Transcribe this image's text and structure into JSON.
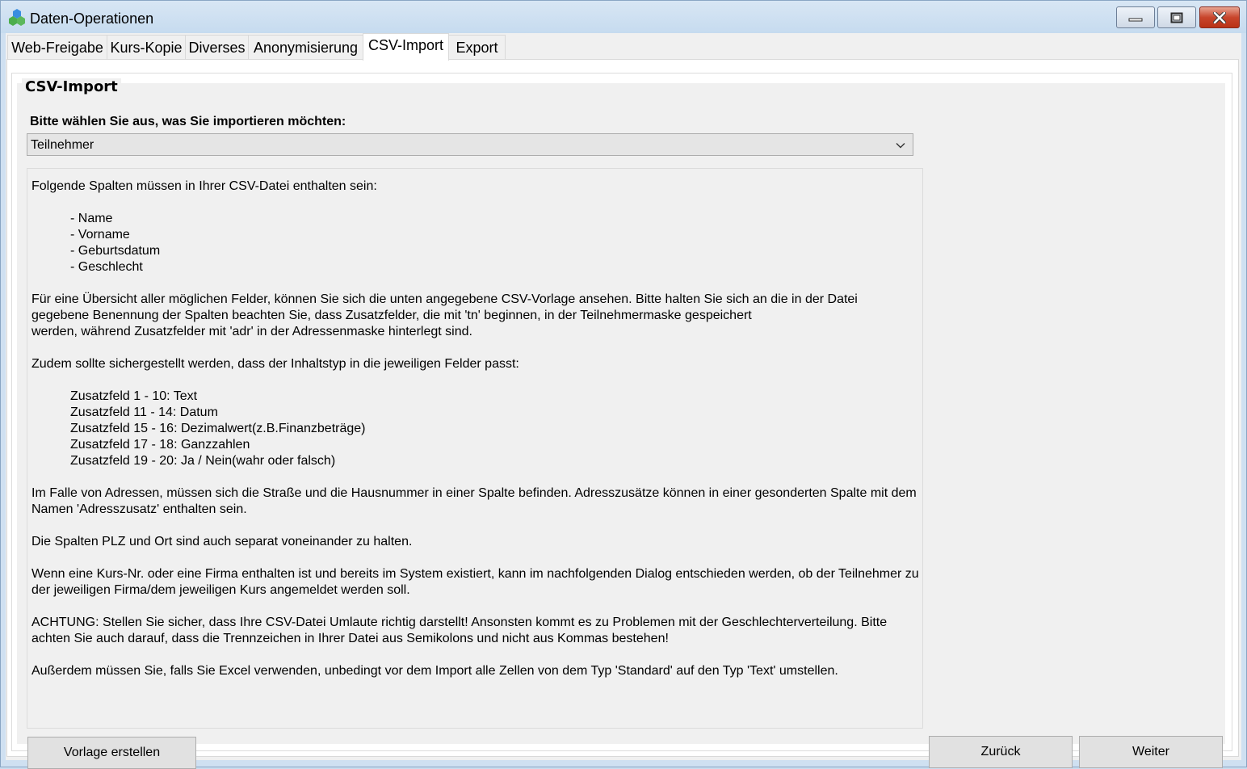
{
  "window": {
    "title": "Daten-Operationen",
    "app_icon": "hexagon-cluster-icon",
    "controls": [
      "minimize-icon",
      "maximize-icon",
      "close-icon"
    ]
  },
  "tabs": [
    {
      "label": "Web-Freigabe",
      "active": false
    },
    {
      "label": "Kurs-Kopie",
      "active": false
    },
    {
      "label": "Diverses",
      "active": false
    },
    {
      "label": "Anonymisierung",
      "active": false
    },
    {
      "label": "CSV-Import",
      "active": true
    },
    {
      "label": "Export",
      "active": false
    }
  ],
  "group": {
    "title": "CSV-Import",
    "prompt": "Bitte wählen Sie aus, was Sie importieren möchten:",
    "select": {
      "value": "Teilnehmer",
      "icon": "chevron-down-icon"
    }
  },
  "info": {
    "intro": "Folgende Spalten müssen in Ihrer CSV-Datei enthalten sein:",
    "required_columns": [
      "- Name",
      "- Vorname",
      "- Geburtsdatum",
      "- Geschlecht"
    ],
    "overview_lines": [
      "Für eine Übersicht aller möglichen Felder, können Sie sich die unten angegebene CSV-Vorlage ansehen. Bitte halten Sie sich an die in der Datei",
      "gegebene Benennung der Spalten beachten Sie, dass Zusatzfelder, die mit 'tn' beginnen, in der Teilnehmermaske gespeichert",
      "werden, während Zusatzfelder mit 'adr' in der Adressenmaske hinterlegt sind."
    ],
    "types_intro": "Zudem sollte sichergestellt werden, dass der Inhaltstyp in die jeweiligen Felder passt:",
    "field_types": [
      "Zusatzfeld 1 - 10: Text",
      "Zusatzfeld 11 - 14: Datum",
      "Zusatzfeld 15 - 16: Dezimalwert(z.B.Finanzbeträge)",
      "Zusatzfeld 17 - 18: Ganzzahlen",
      "Zusatzfeld 19 - 20: Ja / Nein(wahr oder falsch)"
    ],
    "address_lines": [
      "Im Falle von Adressen, müssen sich die Straße und die Hausnummer in einer Spalte befinden. Adresszusätze können in einer gesonderten Spalte mit dem",
      "Namen 'Adresszusatz' enthalten sein."
    ],
    "plz_line": "Die Spalten PLZ und Ort sind auch separat voneinander zu halten.",
    "course_lines": [
      "Wenn eine Kurs-Nr. oder eine Firma enthalten ist und bereits im System existiert, kann im nachfolgenden Dialog entschieden werden, ob der Teilnehmer zu",
      "der jeweiligen Firma/dem jeweiligen Kurs angemeldet werden soll."
    ],
    "warning_lines": [
      "ACHTUNG: Stellen Sie sicher, dass Ihre CSV-Datei Umlaute richtig darstellt! Ansonsten kommt es zu Problemen mit der Geschlechterverteilung. Bitte",
      "achten Sie auch darauf, dass die Trennzeichen in Ihrer Datei aus Semikolons und nicht aus Kommas bestehen!"
    ],
    "excel_line": "Außerdem müssen Sie, falls Sie Excel verwenden, unbedingt vor dem Import alle Zellen von dem Typ 'Standard' auf den Typ 'Text' umstellen."
  },
  "buttons": {
    "template": "Vorlage erstellen",
    "back": "Zurück",
    "next": "Weiter"
  }
}
